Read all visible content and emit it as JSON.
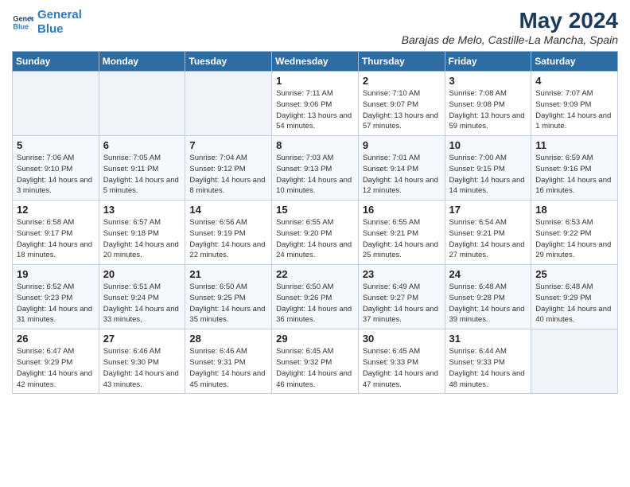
{
  "header": {
    "logo_line1": "General",
    "logo_line2": "Blue",
    "title": "May 2024",
    "subtitle": "Barajas de Melo, Castille-La Mancha, Spain"
  },
  "weekdays": [
    "Sunday",
    "Monday",
    "Tuesday",
    "Wednesday",
    "Thursday",
    "Friday",
    "Saturday"
  ],
  "weeks": [
    [
      {
        "day": null
      },
      {
        "day": null
      },
      {
        "day": null
      },
      {
        "day": 1,
        "sunrise": "7:11 AM",
        "sunset": "9:06 PM",
        "daylight": "13 hours and 54 minutes."
      },
      {
        "day": 2,
        "sunrise": "7:10 AM",
        "sunset": "9:07 PM",
        "daylight": "13 hours and 57 minutes."
      },
      {
        "day": 3,
        "sunrise": "7:08 AM",
        "sunset": "9:08 PM",
        "daylight": "13 hours and 59 minutes."
      },
      {
        "day": 4,
        "sunrise": "7:07 AM",
        "sunset": "9:09 PM",
        "daylight": "14 hours and 1 minute."
      }
    ],
    [
      {
        "day": 5,
        "sunrise": "7:06 AM",
        "sunset": "9:10 PM",
        "daylight": "14 hours and 3 minutes."
      },
      {
        "day": 6,
        "sunrise": "7:05 AM",
        "sunset": "9:11 PM",
        "daylight": "14 hours and 5 minutes."
      },
      {
        "day": 7,
        "sunrise": "7:04 AM",
        "sunset": "9:12 PM",
        "daylight": "14 hours and 8 minutes."
      },
      {
        "day": 8,
        "sunrise": "7:03 AM",
        "sunset": "9:13 PM",
        "daylight": "14 hours and 10 minutes."
      },
      {
        "day": 9,
        "sunrise": "7:01 AM",
        "sunset": "9:14 PM",
        "daylight": "14 hours and 12 minutes."
      },
      {
        "day": 10,
        "sunrise": "7:00 AM",
        "sunset": "9:15 PM",
        "daylight": "14 hours and 14 minutes."
      },
      {
        "day": 11,
        "sunrise": "6:59 AM",
        "sunset": "9:16 PM",
        "daylight": "14 hours and 16 minutes."
      }
    ],
    [
      {
        "day": 12,
        "sunrise": "6:58 AM",
        "sunset": "9:17 PM",
        "daylight": "14 hours and 18 minutes."
      },
      {
        "day": 13,
        "sunrise": "6:57 AM",
        "sunset": "9:18 PM",
        "daylight": "14 hours and 20 minutes."
      },
      {
        "day": 14,
        "sunrise": "6:56 AM",
        "sunset": "9:19 PM",
        "daylight": "14 hours and 22 minutes."
      },
      {
        "day": 15,
        "sunrise": "6:55 AM",
        "sunset": "9:20 PM",
        "daylight": "14 hours and 24 minutes."
      },
      {
        "day": 16,
        "sunrise": "6:55 AM",
        "sunset": "9:21 PM",
        "daylight": "14 hours and 25 minutes."
      },
      {
        "day": 17,
        "sunrise": "6:54 AM",
        "sunset": "9:21 PM",
        "daylight": "14 hours and 27 minutes."
      },
      {
        "day": 18,
        "sunrise": "6:53 AM",
        "sunset": "9:22 PM",
        "daylight": "14 hours and 29 minutes."
      }
    ],
    [
      {
        "day": 19,
        "sunrise": "6:52 AM",
        "sunset": "9:23 PM",
        "daylight": "14 hours and 31 minutes."
      },
      {
        "day": 20,
        "sunrise": "6:51 AM",
        "sunset": "9:24 PM",
        "daylight": "14 hours and 33 minutes."
      },
      {
        "day": 21,
        "sunrise": "6:50 AM",
        "sunset": "9:25 PM",
        "daylight": "14 hours and 35 minutes."
      },
      {
        "day": 22,
        "sunrise": "6:50 AM",
        "sunset": "9:26 PM",
        "daylight": "14 hours and 36 minutes."
      },
      {
        "day": 23,
        "sunrise": "6:49 AM",
        "sunset": "9:27 PM",
        "daylight": "14 hours and 37 minutes."
      },
      {
        "day": 24,
        "sunrise": "6:48 AM",
        "sunset": "9:28 PM",
        "daylight": "14 hours and 39 minutes."
      },
      {
        "day": 25,
        "sunrise": "6:48 AM",
        "sunset": "9:29 PM",
        "daylight": "14 hours and 40 minutes."
      }
    ],
    [
      {
        "day": 26,
        "sunrise": "6:47 AM",
        "sunset": "9:29 PM",
        "daylight": "14 hours and 42 minutes."
      },
      {
        "day": 27,
        "sunrise": "6:46 AM",
        "sunset": "9:30 PM",
        "daylight": "14 hours and 43 minutes."
      },
      {
        "day": 28,
        "sunrise": "6:46 AM",
        "sunset": "9:31 PM",
        "daylight": "14 hours and 45 minutes."
      },
      {
        "day": 29,
        "sunrise": "6:45 AM",
        "sunset": "9:32 PM",
        "daylight": "14 hours and 46 minutes."
      },
      {
        "day": 30,
        "sunrise": "6:45 AM",
        "sunset": "9:33 PM",
        "daylight": "14 hours and 47 minutes."
      },
      {
        "day": 31,
        "sunrise": "6:44 AM",
        "sunset": "9:33 PM",
        "daylight": "14 hours and 48 minutes."
      },
      {
        "day": null
      }
    ]
  ],
  "labels": {
    "sunrise": "Sunrise:",
    "sunset": "Sunset:",
    "daylight": "Daylight:"
  }
}
